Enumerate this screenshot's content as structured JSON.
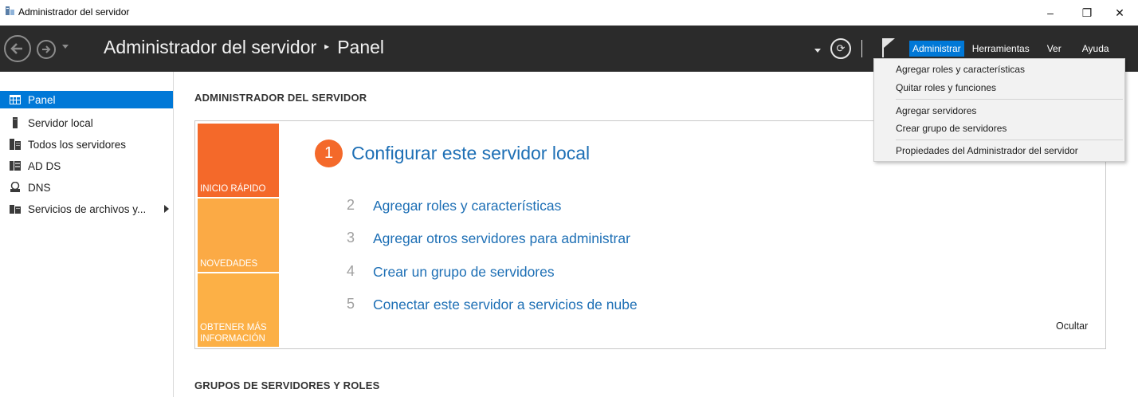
{
  "window": {
    "title": "Administrador del servidor",
    "minimize_glyph": "–",
    "restore_glyph": "❐",
    "close_glyph": "✕"
  },
  "header": {
    "breadcrumb_root": "Administrador del servidor",
    "breadcrumb_sep": "▸",
    "breadcrumb_page": "Panel",
    "menu": {
      "administrar": "Administrar",
      "herramientas": "Herramientas",
      "ver": "Ver",
      "ayuda": "Ayuda"
    }
  },
  "sidebar": {
    "items": [
      {
        "label": "Panel",
        "icon": "dashboard-icon",
        "selected": true
      },
      {
        "label": "Servidor local",
        "icon": "server-icon"
      },
      {
        "label": "Todos los servidores",
        "icon": "servers-icon"
      },
      {
        "label": "AD DS",
        "icon": "ad-ds-icon"
      },
      {
        "label": "DNS",
        "icon": "dns-icon"
      },
      {
        "label": "Servicios de archivos y...",
        "icon": "file-services-icon",
        "has_submenu": true
      }
    ]
  },
  "main": {
    "section_title": "ADMINISTRADOR DEL SERVIDOR",
    "tiles": {
      "quick_start": "INICIO RÁPIDO",
      "whats_new": "NOVEDADES",
      "learn_more_1": "OBTENER MÁS",
      "learn_more_2": "INFORMACIÓN"
    },
    "steps": [
      {
        "num": "1",
        "label": "Configurar este servidor local"
      },
      {
        "num": "2",
        "label": "Agregar roles y características"
      },
      {
        "num": "3",
        "label": "Agregar otros servidores para administrar"
      },
      {
        "num": "4",
        "label": "Crear un grupo de servidores"
      },
      {
        "num": "5",
        "label": "Conectar este servidor a servicios de nube"
      }
    ],
    "hide_label": "Ocultar",
    "groups_title": "GRUPOS DE SERVIDORES Y ROLES"
  },
  "dropdown": {
    "items": [
      "Agregar roles y características",
      "Quitar roles y funciones",
      "Agregar servidores",
      "Crear grupo de servidores",
      "Propiedades del Administrador del servidor"
    ]
  },
  "colors": {
    "accent": "#0078d7",
    "header_bg": "#2b2b2b",
    "tile_orange": "#f4692a",
    "tile_amber": "#fbaa45",
    "link_blue": "#1d6fb5"
  }
}
